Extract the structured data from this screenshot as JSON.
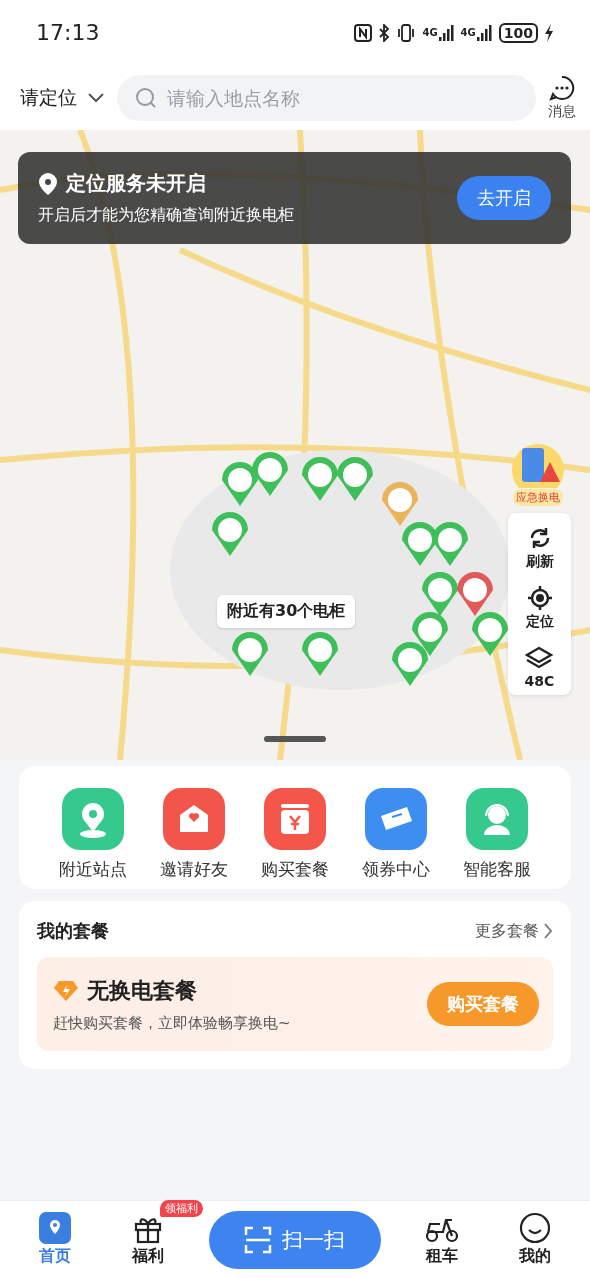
{
  "status_bar": {
    "time": "17:13",
    "network_labels": [
      "4G",
      "4G"
    ],
    "battery": "100"
  },
  "header": {
    "location": "请定位",
    "search": {
      "placeholder": "请输入地点名称"
    },
    "message": "消息"
  },
  "map": {
    "kind": "picture",
    "banner": {
      "title": "定位服务未开启",
      "text": "开启后才能为您精确查询附近换电柜",
      "button": "去开启"
    },
    "emergency": "应急换电",
    "count_label": "附近有30个电柜",
    "controls": [
      {
        "kind": "refresh",
        "label": "刷新"
      },
      {
        "kind": "locate",
        "label": "定位"
      },
      {
        "kind": "layers",
        "label": "48C"
      }
    ]
  },
  "shortcuts": [
    {
      "kind": "station",
      "label": "附近站点",
      "color": "#36c98e"
    },
    {
      "kind": "invite",
      "label": "邀请好友",
      "color": "#f2554a"
    },
    {
      "kind": "buy",
      "label": "购买套餐",
      "color": "#f4574a"
    },
    {
      "kind": "coupon",
      "label": "领券中心",
      "color": "#3d8ef0"
    },
    {
      "kind": "service",
      "label": "智能客服",
      "color": "#36c98e"
    }
  ],
  "package": {
    "title": "我的套餐",
    "more": "更多套餐",
    "name": "无换电套餐",
    "text": "赶快购买套餐，立即体验畅享换电~",
    "button": "购买套餐"
  },
  "tab_bar": [
    {
      "kind": "home",
      "label": "首页",
      "selected": true
    },
    {
      "kind": "gift",
      "label": "福利",
      "badge": "领福利",
      "selected": false
    },
    {
      "kind": "scan",
      "label": "扫一扫"
    },
    {
      "kind": "scooter",
      "label": "租车",
      "selected": false
    },
    {
      "kind": "profile",
      "label": "我的",
      "selected": false
    }
  ]
}
